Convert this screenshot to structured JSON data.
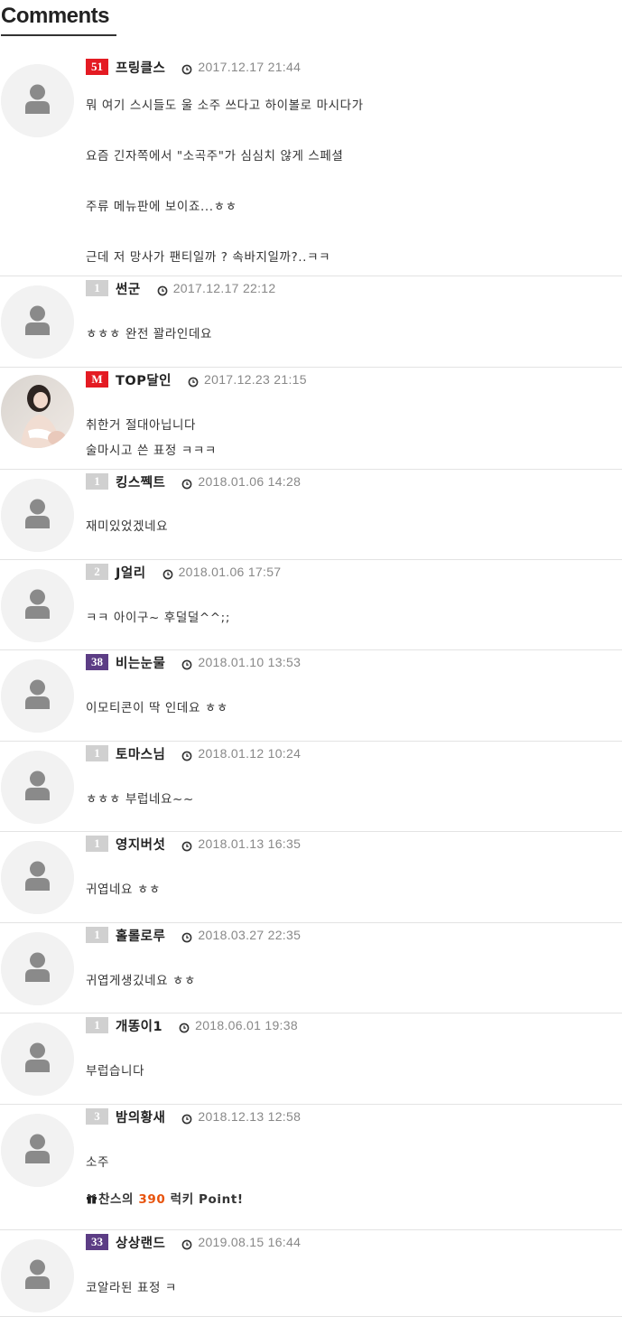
{
  "section_title": "Comments",
  "colors": {
    "level_red": "#e41b23",
    "level_gray": "#d0d0d0",
    "level_purple": "#5c3d85",
    "point_number": "#e8540e"
  },
  "comments": [
    {
      "level": "51",
      "nickname": "프링클스",
      "date": "2017.12.17 21:44",
      "lines": [
        "뭐 여기 스시들도 울 소주 쓰다고 하이볼로 마시다가",
        "요즘 긴자쪽에서 \"소곡주\"가 심심치 않게 스페셜",
        "주류 메뉴판에 보이죠...ㅎㅎ",
        "근데 저 망사가 팬티일까 ? 속바지일까?..ㅋㅋ"
      ]
    },
    {
      "level": "1",
      "nickname": "썬군",
      "date": "2017.12.17 22:12",
      "lines": [
        "ㅎㅎㅎ 완전 꽐라인데요"
      ]
    },
    {
      "level": "M",
      "nickname": "TOP달인",
      "date": "2017.12.23 21:15",
      "lines": [
        "취한거 절대아닙니다",
        "술마시고 쓴 표정 ㅋㅋㅋ"
      ]
    },
    {
      "level": "1",
      "nickname": "킹스쩩트",
      "date": "2018.01.06 14:28",
      "lines": [
        "재미있었겠네요"
      ]
    },
    {
      "level": "2",
      "nickname": "J얼리",
      "date": "2018.01.06 17:57",
      "lines": [
        "ㅋㅋ 아이구~ 후덜덜^^;;"
      ]
    },
    {
      "level": "38",
      "nickname": "비는눈물",
      "date": "2018.01.10 13:53",
      "lines": [
        "이모티콘이 딱 인데요 ㅎㅎ"
      ]
    },
    {
      "level": "1",
      "nickname": "토마스님",
      "date": "2018.01.12 10:24",
      "lines": [
        "ㅎㅎㅎ 부럽네요~~"
      ]
    },
    {
      "level": "1",
      "nickname": "영지버섯",
      "date": "2018.01.13 16:35",
      "lines": [
        "귀엽네요 ㅎㅎ"
      ]
    },
    {
      "level": "1",
      "nickname": "홀롤로루",
      "date": "2018.03.27 22:35",
      "lines": [
        "귀엽게생깄네요 ㅎㅎ"
      ]
    },
    {
      "level": "1",
      "nickname": "개똥이1",
      "date": "2018.06.01 19:38",
      "lines": [
        "부럽습니다"
      ]
    },
    {
      "level": "3",
      "nickname": "밤의황새",
      "date": "2018.12.13 12:58",
      "lines": [
        "소주"
      ],
      "point": {
        "prefix": "찬스의",
        "amount": "390",
        "suffix": "럭키 Point!"
      }
    },
    {
      "level": "33",
      "nickname": "상상랜드",
      "date": "2019.08.15 16:44",
      "lines": [
        "코알라된 표정 ㅋ"
      ]
    }
  ]
}
